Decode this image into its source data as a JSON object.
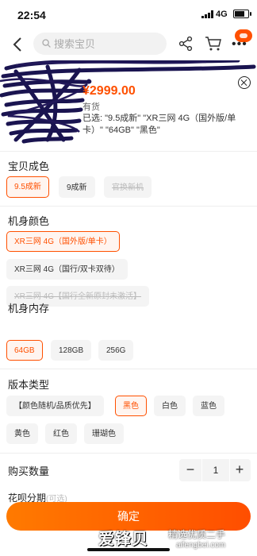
{
  "status_bar": {
    "time": "22:54",
    "network": "4G"
  },
  "nav": {
    "search_placeholder": "搜索宝贝"
  },
  "product": {
    "price": "¥2999.00",
    "stock": "有货",
    "selected_text": "已选: \"9.5成新\" \"XR三网 4G（国外版/单卡）\" \"64GB\" \"黑色\""
  },
  "sections": {
    "condition": {
      "title": "宝贝成色",
      "options": [
        {
          "label": "9.5成新",
          "state": "selected"
        },
        {
          "label": "9成新",
          "state": "normal"
        },
        {
          "label": "官换新机",
          "state": "disabled"
        }
      ]
    },
    "model": {
      "title": "机身颜色",
      "options": [
        {
          "label": "XR三网 4G（国外版/单卡）",
          "state": "selected"
        },
        {
          "label": "XR三网 4G（国行/双卡双待）",
          "state": "normal"
        },
        {
          "label": "XR三网 4G【国行全新原封未激活】",
          "state": "disabled"
        }
      ]
    },
    "storage": {
      "title": "机身内存",
      "options": [
        {
          "label": "64GB",
          "state": "selected"
        },
        {
          "label": "128GB",
          "state": "normal"
        },
        {
          "label": "256G",
          "state": "normal"
        }
      ]
    },
    "version": {
      "title": "版本类型",
      "options": [
        {
          "label": "【颜色随机/品质优先】",
          "state": "normal"
        },
        {
          "label": "黑色",
          "state": "selected"
        },
        {
          "label": "白色",
          "state": "normal"
        },
        {
          "label": "蓝色",
          "state": "normal"
        },
        {
          "label": "黄色",
          "state": "normal"
        },
        {
          "label": "红色",
          "state": "normal"
        },
        {
          "label": "珊瑚色",
          "state": "normal"
        }
      ]
    }
  },
  "quantity": {
    "label": "购买数量",
    "minus": "−",
    "value": "1",
    "plus": "+"
  },
  "installment": {
    "label": "花呗分期",
    "sub": "(可选)"
  },
  "confirm_label": "确定",
  "watermark": {
    "logo": "爱锋贝",
    "tagline": "精选优质二手",
    "url": "aifengbei.com"
  },
  "colors": {
    "accent": "#ff5000",
    "selected_bg": "#fff5f0",
    "option_bg": "#f4f4f4"
  }
}
